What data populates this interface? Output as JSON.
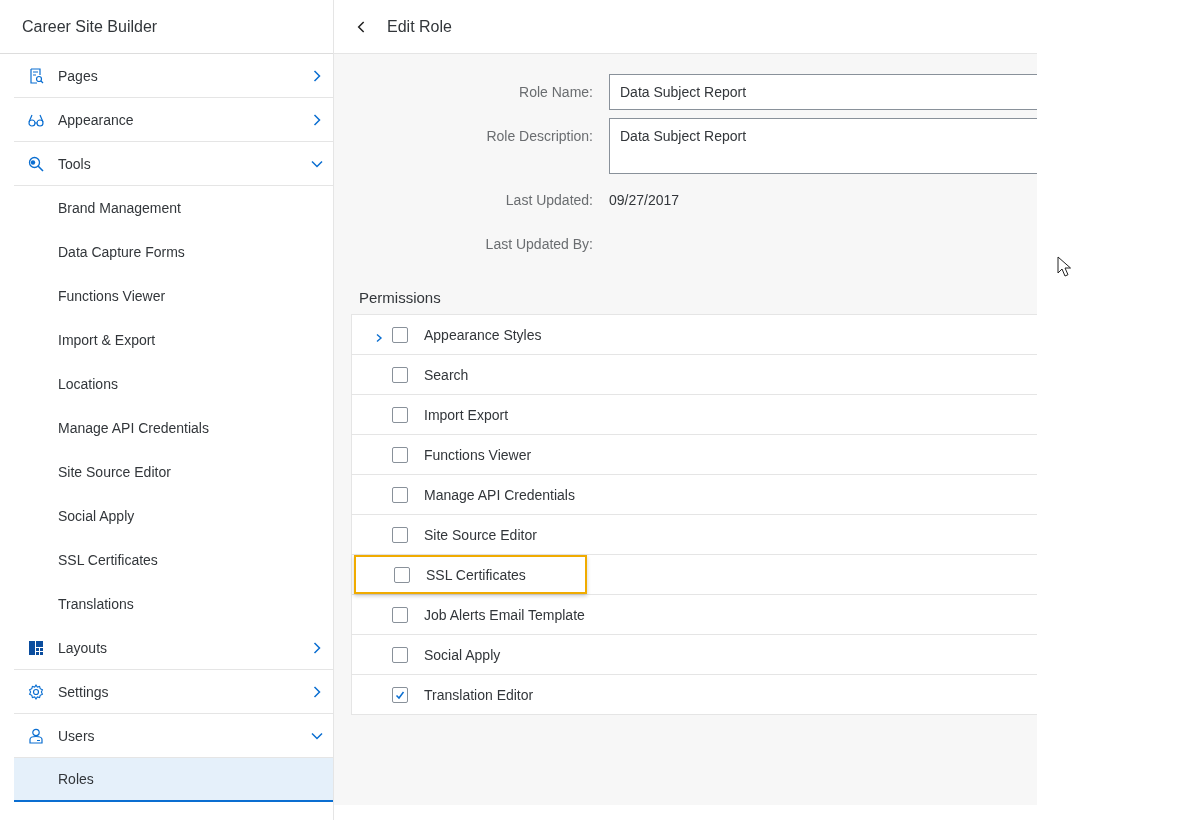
{
  "sidebar": {
    "title": "Career Site Builder",
    "items": [
      {
        "label": "Pages",
        "expanded": false
      },
      {
        "label": "Appearance",
        "expanded": false
      },
      {
        "label": "Tools",
        "expanded": true,
        "children": [
          {
            "label": "Brand Management",
            "selected": false
          },
          {
            "label": "Data Capture Forms",
            "selected": false
          },
          {
            "label": "Functions Viewer",
            "selected": false
          },
          {
            "label": "Import & Export",
            "selected": false
          },
          {
            "label": "Locations",
            "selected": false
          },
          {
            "label": "Manage API Credentials",
            "selected": false
          },
          {
            "label": "Site Source Editor",
            "selected": false
          },
          {
            "label": "Social Apply",
            "selected": false
          },
          {
            "label": "SSL Certificates",
            "selected": false
          },
          {
            "label": "Translations",
            "selected": false
          }
        ]
      },
      {
        "label": "Layouts",
        "expanded": false
      },
      {
        "label": "Settings",
        "expanded": false
      },
      {
        "label": "Users",
        "expanded": true,
        "children": [
          {
            "label": "Roles",
            "selected": true
          }
        ]
      }
    ]
  },
  "header": {
    "title": "Edit Role"
  },
  "form": [
    {
      "kind": "input",
      "label": "Role Name:",
      "value": "Data Subject Report"
    },
    {
      "kind": "textarea",
      "label": "Role Description:",
      "value": "Data Subject Report"
    },
    {
      "kind": "text",
      "label": "Last Updated:",
      "value": "09/27/2017"
    },
    {
      "kind": "text",
      "label": "Last Updated By:"
    }
  ],
  "permissions": {
    "title": "Permissions",
    "rows": [
      {
        "label": "Appearance Styles",
        "checked": false,
        "expandable": true,
        "highlighted": false
      },
      {
        "label": "Search",
        "checked": false,
        "expandable": false,
        "highlighted": false
      },
      {
        "label": "Import Export",
        "checked": false,
        "expandable": false,
        "highlighted": false
      },
      {
        "label": "Functions Viewer",
        "checked": false,
        "expandable": false,
        "highlighted": false
      },
      {
        "label": "Manage API Credentials",
        "checked": false,
        "expandable": false,
        "highlighted": false
      },
      {
        "label": "Site Source Editor",
        "checked": false,
        "expandable": false,
        "highlighted": false
      },
      {
        "label": "SSL Certificates",
        "checked": false,
        "expandable": false,
        "highlighted": true
      },
      {
        "label": "Job Alerts Email Template",
        "checked": false,
        "expandable": false,
        "highlighted": false
      },
      {
        "label": "Social Apply",
        "checked": false,
        "expandable": false,
        "highlighted": false
      },
      {
        "label": "Translation Editor",
        "checked": true,
        "expandable": false,
        "highlighted": false
      }
    ]
  }
}
